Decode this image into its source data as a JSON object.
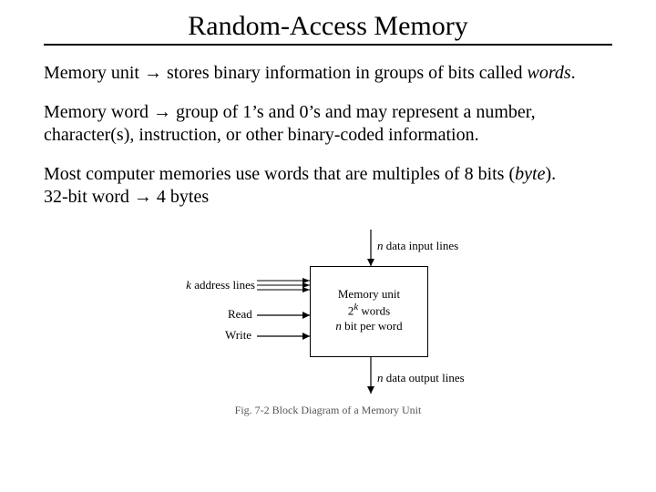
{
  "title": "Random-Access Memory",
  "para1": {
    "lead": "Memory unit ",
    "arrow": "→",
    "rest": " stores binary information in groups of bits called ",
    "em": "words",
    "tail": "."
  },
  "para2": {
    "lead": "Memory word ",
    "arrow": "→",
    "rest": " group of 1’s and 0’s and may represent a number, character(s), instruction, or other binary-coded information."
  },
  "para3": {
    "line1a": "Most computer memories use words that are multiples of 8 bits (",
    "byte": "byte",
    "line1b": ").",
    "line2a": "32-bit word ",
    "arrow": "→",
    "line2b": " 4 bytes"
  },
  "figure": {
    "top_n": "n",
    "top_rest": " data input lines",
    "addr_k": "k",
    "addr_rest": " address lines",
    "read": "Read",
    "write": "Write",
    "box_line1": "Memory unit",
    "box_line2_pre": "2",
    "box_line2_sup": "k",
    "box_line2_post": " words",
    "box_line3_n": "n",
    "box_line3_rest": " bit per word",
    "bottom_n": "n",
    "bottom_rest": " data output lines",
    "caption": "Fig. 7-2  Block Diagram of a Memory Unit"
  }
}
